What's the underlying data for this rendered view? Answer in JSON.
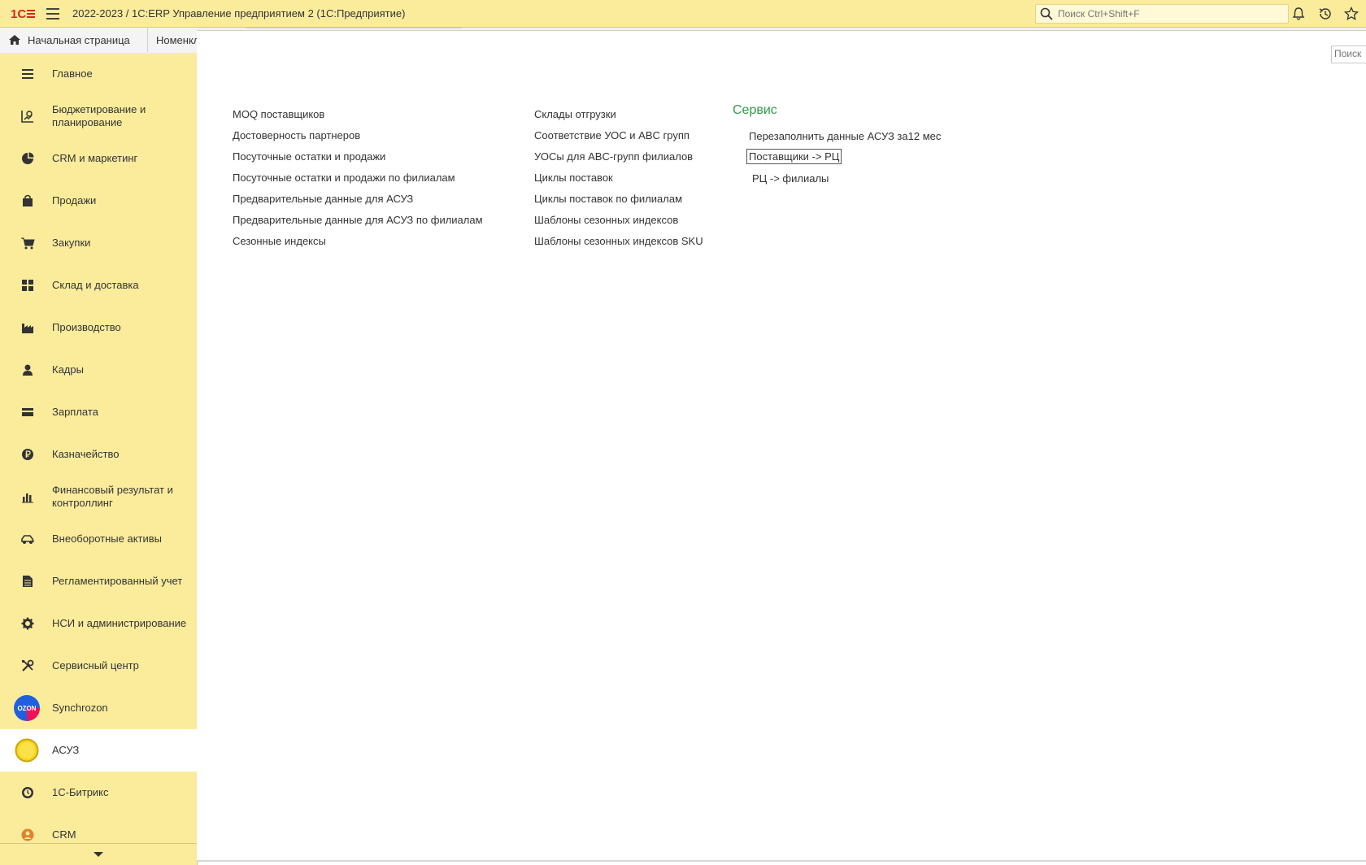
{
  "window": {
    "title": "2022-2023 / 1С:ERP Управление предприятием 2  (1С:Предприятие)",
    "search_placeholder": "Поиск Ctrl+Shift+F"
  },
  "tabs": {
    "home_label": "Начальная страница",
    "second_label": "Номенклатура"
  },
  "sidebar": {
    "items": [
      {
        "label": "Главное",
        "icon": "list-icon"
      },
      {
        "label": "Бюджетирование и планирование",
        "icon": "budget-icon"
      },
      {
        "label": "CRM и маркетинг",
        "icon": "pie-chart-icon"
      },
      {
        "label": "Продажи",
        "icon": "bag-icon"
      },
      {
        "label": "Закупки",
        "icon": "cart-icon"
      },
      {
        "label": "Склад и доставка",
        "icon": "warehouse-icon"
      },
      {
        "label": "Производство",
        "icon": "factory-icon"
      },
      {
        "label": "Кадры",
        "icon": "person-icon"
      },
      {
        "label": "Зарплата",
        "icon": "wallet-icon"
      },
      {
        "label": "Казначейство",
        "icon": "ruble-coin-icon"
      },
      {
        "label": "Финансовый результат и контроллинг",
        "icon": "bar-chart-icon"
      },
      {
        "label": "Внеоборотные активы",
        "icon": "car-icon"
      },
      {
        "label": "Регламентированный учет",
        "icon": "document-icon"
      },
      {
        "label": "НСИ и администрирование",
        "icon": "gear-icon"
      },
      {
        "label": "Сервисный центр",
        "icon": "tools-icon"
      },
      {
        "label": "Synchrozon",
        "icon": "ozon-icon",
        "badge": "OZON"
      },
      {
        "label": "АСУЗ",
        "icon": "yellow-circle-icon",
        "active": true
      },
      {
        "label": "1С-Битрикс",
        "icon": "bitrix-icon"
      },
      {
        "label": "CRM",
        "icon": "user-circle-icon"
      }
    ]
  },
  "main": {
    "search_placeholder": "Поиск",
    "col1": [
      "MOQ поставщиков",
      "Достоверность партнеров",
      "Посуточные остатки и продажи",
      "Посуточные остатки и продажи по филиалам",
      "Предварительные данные для АСУЗ",
      "Предварительные данные для АСУЗ  по филиалам",
      "Сезонные индексы"
    ],
    "col2": [
      "Склады отгрузки",
      "Соответствие УОС и ABC групп",
      "УОСы для ABC-групп филиалов",
      "Циклы поставок",
      "Циклы поставок по филиалам",
      "Шаблоны сезонных индексов",
      "Шаблоны сезонных индексов SKU"
    ],
    "service": {
      "title": "Сервис",
      "items": [
        "Перезаполнить данные АСУЗ за12 мес",
        "Поставщики -> РЦ",
        "РЦ -> филиалы"
      ]
    }
  },
  "colors": {
    "accent_yellow": "#fbec9c",
    "service_green": "#2e9b4a",
    "logo_red": "#d9261c"
  }
}
